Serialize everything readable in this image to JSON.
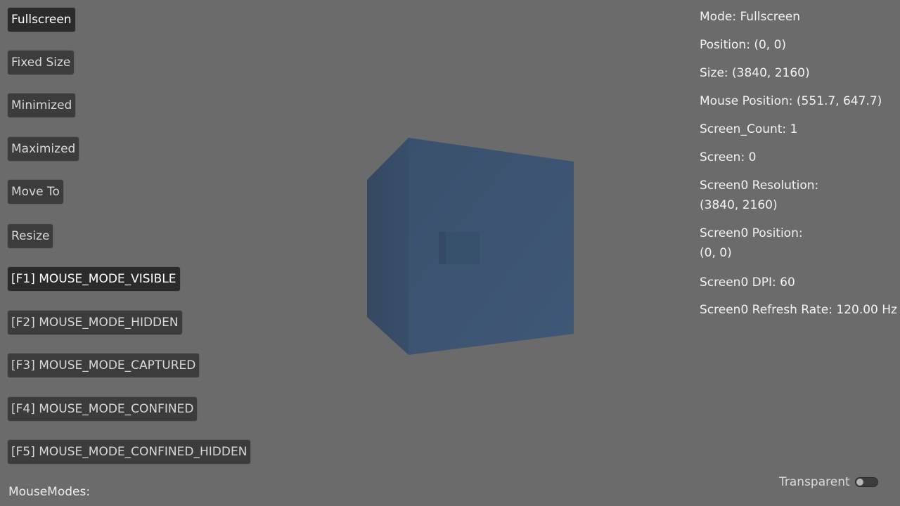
{
  "buttons": {
    "fullscreen": "Fullscreen",
    "fixed_size": "Fixed Size",
    "minimized": "Minimized",
    "maximized": "Maximized",
    "move_to": "Move To",
    "resize": "Resize",
    "f1": "[F1] MOUSE_MODE_VISIBLE",
    "f2": "[F2] MOUSE_MODE_HIDDEN",
    "f3": "[F3] MOUSE_MODE_CAPTURED",
    "f4": "[F4] MOUSE_MODE_CONFINED",
    "f5": "[F5] MOUSE_MODE_CONFINED_HIDDEN"
  },
  "mousemodes_label": "MouseModes:",
  "info": {
    "mode": "Mode: Fullscreen",
    "position": "Position: (0, 0)",
    "size": "Size: (3840, 2160)",
    "mouse_position": "Mouse Position: (551.7, 647.7)",
    "screen_count": "Screen_Count: 1",
    "screen": "Screen: 0",
    "screen0_resolution_label": "Screen0 Resolution:",
    "screen0_resolution_value": "(3840, 2160)",
    "screen0_position_label": "Screen0 Position:",
    "screen0_position_value": "(0, 0)",
    "screen0_dpi": "Screen0 DPI: 60",
    "screen0_refresh_rate": "Screen0 Refresh Rate: 120.00 Hz"
  },
  "transparent": {
    "label": "Transparent",
    "enabled": false
  },
  "colors": {
    "background": "#6b6b6b",
    "button": "#3c3c3c",
    "button_active": "#2b2b2b",
    "cube_front": "#3d5572",
    "cube_side": "#344962"
  }
}
